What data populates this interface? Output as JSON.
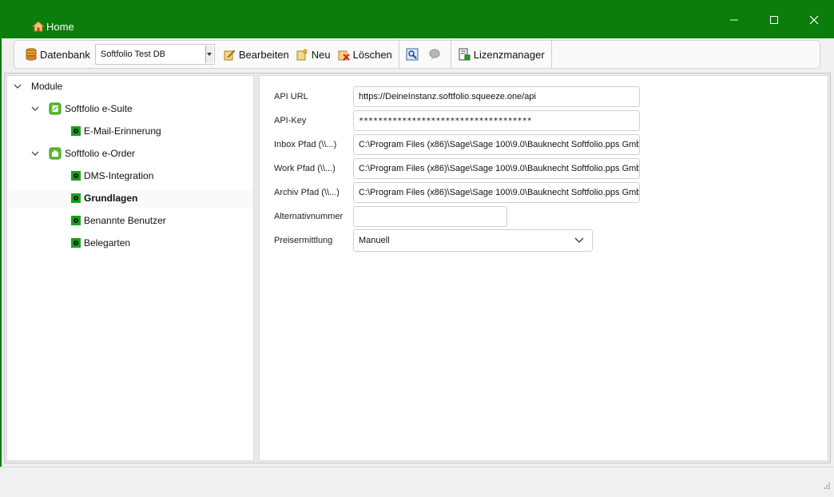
{
  "window": {
    "title": "Home"
  },
  "toolbar": {
    "datenbank_label": "Datenbank",
    "db_selected": "Softfolio Test DB",
    "edit_label": "Bearbeiten",
    "new_label": "Neu",
    "delete_label": "Löschen",
    "license_label": "Lizenzmanager"
  },
  "tree": {
    "root": "Module",
    "groups": [
      {
        "label": "Softfolio e-Suite",
        "children": [
          {
            "label": "E-Mail-Erinnerung"
          }
        ]
      },
      {
        "label": "Softfolio e-Order",
        "children": [
          {
            "label": "DMS-Integration"
          },
          {
            "label": "Grundlagen"
          },
          {
            "label": "Benannte Benutzer"
          },
          {
            "label": "Belegarten"
          }
        ]
      }
    ]
  },
  "form": {
    "api_url": {
      "label": "API URL",
      "value": "https://DeineInstanz.softfolio.squeeze.one/api"
    },
    "api_key": {
      "label": "API-Key",
      "value": "************************************"
    },
    "inbox": {
      "label": "Inbox Pfad (\\\\...)",
      "value": "C:\\Program Files (x86)\\Sage\\Sage 100\\9.0\\Bauknecht Softfolio.pps Gmb"
    },
    "work": {
      "label": "Work Pfad (\\\\...)",
      "value": "C:\\Program Files (x86)\\Sage\\Sage 100\\9.0\\Bauknecht Softfolio.pps Gmb"
    },
    "archiv": {
      "label": "Archiv Pfad (\\\\...)",
      "value": "C:\\Program Files (x86)\\Sage\\Sage 100\\9.0\\Bauknecht Softfolio.pps Gmb"
    },
    "alt": {
      "label": "Alternativnummer",
      "value": ""
    },
    "preis": {
      "label": "Preisermittlung",
      "value": "Manuell"
    }
  },
  "colors": {
    "titlebar": "#0a7d0a",
    "accent_green": "#1a9a1a"
  }
}
